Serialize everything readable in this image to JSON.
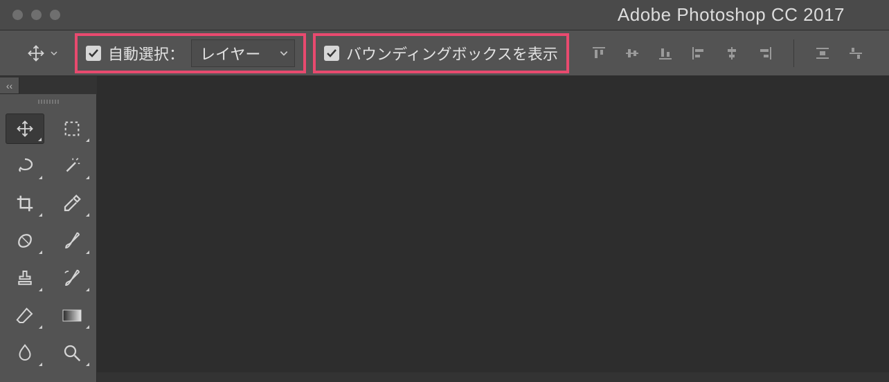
{
  "titlebar": {
    "title": "Adobe Photoshop CC 2017"
  },
  "options_bar": {
    "auto_select": {
      "checked": true,
      "label": "自動選択：",
      "dropdown_value": "レイヤー"
    },
    "show_bounding_box": {
      "checked": true,
      "label": "バウンディングボックスを表示"
    },
    "align_buttons": [
      "align-top",
      "align-vcenter",
      "align-bottom",
      "align-left",
      "align-hcenter",
      "align-right",
      "distribute-h",
      "distribute-v"
    ]
  },
  "collapse": {
    "glyph": "‹‹"
  },
  "tools": {
    "rows": [
      [
        "move-tool",
        "marquee-tool"
      ],
      [
        "lasso-tool",
        "magic-wand-tool"
      ],
      [
        "crop-tool",
        "eyedropper-tool"
      ],
      [
        "patch-tool",
        "brush-tool"
      ],
      [
        "stamp-tool",
        "history-brush-tool"
      ],
      [
        "eraser-tool",
        "gradient-tool"
      ],
      [
        "smudge-tool",
        "dodge-tool"
      ]
    ],
    "active": "move-tool"
  }
}
